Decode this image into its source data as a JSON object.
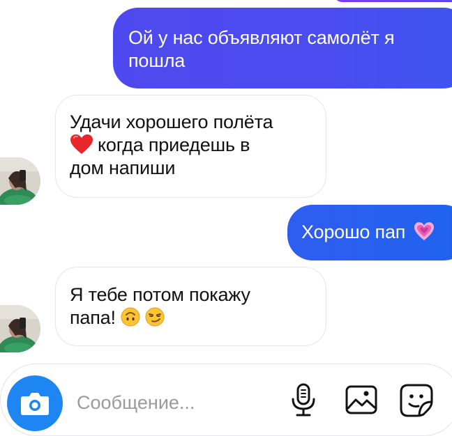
{
  "messages": [
    {
      "side": "sent",
      "text": "Ой у нас объявляют самолёт я пошла"
    },
    {
      "side": "received",
      "line1": "Удачи хорошего полёта",
      "line2_after_emoji": "когда приедешь в",
      "line3": "дом напиши",
      "emoji": "red-heart"
    },
    {
      "side": "sent",
      "text": "Хорошо пап",
      "emoji": "growing-heart"
    },
    {
      "side": "received",
      "line1": "Я тебе потом покажу",
      "line2": "папа!",
      "emojis": [
        "upside-down-face",
        "smirking-face"
      ]
    }
  ],
  "composer": {
    "placeholder": "Сообщение...",
    "icons": [
      "camera-icon",
      "microphone-icon",
      "gallery-icon",
      "sticker-icon"
    ]
  },
  "colors": {
    "sent_gradient_start": "#4e49ee",
    "sent_gradient_end": "#1f63ee",
    "camera_button": "#1d86f2",
    "received_border": "#e6e6ea"
  }
}
